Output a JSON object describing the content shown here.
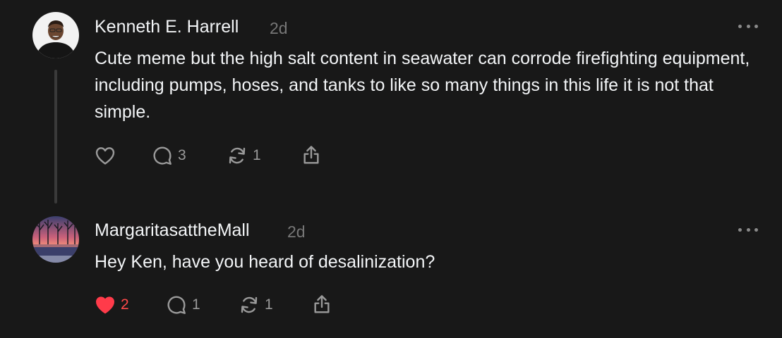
{
  "comments": [
    {
      "author": "Kenneth E. Harrell",
      "time": "2d",
      "avatar": "profile-photo-avatar",
      "text": "Cute meme but the high salt content in seawater can corrode firefighting equipment, including pumps, hoses, and tanks to like so many things in this life it is not that simple.",
      "actions": {
        "like": {
          "icon": "heart-outline-icon",
          "count": ""
        },
        "reply": {
          "icon": "speech-bubble-icon",
          "count": "3"
        },
        "repost": {
          "icon": "repost-arrows-icon",
          "count": "1"
        },
        "share": {
          "icon": "share-upload-icon"
        }
      }
    },
    {
      "author": "MargaritasattheMall",
      "time": "2d",
      "avatar": "sunset-landscape-avatar",
      "text": "Hey Ken, have you heard of desalinization?",
      "actions": {
        "like": {
          "icon": "heart-filled-icon",
          "count": "2",
          "liked": true
        },
        "reply": {
          "icon": "speech-bubble-icon",
          "count": "1"
        },
        "repost": {
          "icon": "repost-arrows-icon",
          "count": "1"
        },
        "share": {
          "icon": "share-upload-icon"
        }
      }
    }
  ],
  "colors": {
    "background": "#181818",
    "text": "#f3f5f7",
    "muted": "#777777",
    "like_active": "#ff3040"
  }
}
